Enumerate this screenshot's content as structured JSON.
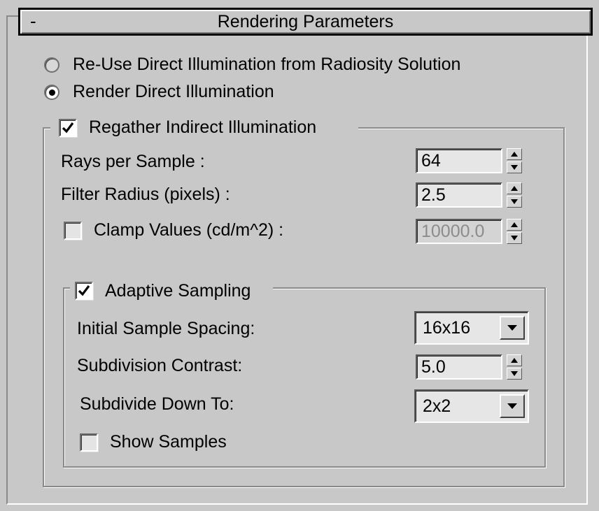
{
  "rollout": {
    "toggle": "-",
    "title": "Rendering Parameters"
  },
  "radios": [
    {
      "label": "Re-Use Direct Illumination from Radiosity Solution",
      "selected": false
    },
    {
      "label": "Render Direct Illumination",
      "selected": true
    }
  ],
  "regather": {
    "label": "Regather Indirect Illumination",
    "checked": true,
    "rays_label": "Rays per Sample :",
    "rays_value": "64",
    "filter_label": "Filter Radius (pixels) :",
    "filter_value": "2.5",
    "clamp_label": "Clamp Values (cd/m^2) :",
    "clamp_checked": false,
    "clamp_value": "10000.0"
  },
  "adaptive": {
    "label": "Adaptive Sampling",
    "checked": true,
    "initial_spacing_label": "Initial Sample Spacing:",
    "initial_spacing_value": "16x16",
    "contrast_label": "Subdivision Contrast:",
    "contrast_value": "5.0",
    "subdivide_label": "Subdivide Down To:",
    "subdivide_value": "2x2",
    "show_samples_label": "Show Samples",
    "show_samples_checked": false
  },
  "icons": {
    "check": "check-mark",
    "spinner_up": "triangle-up",
    "spinner_down": "triangle-down",
    "dropdown": "triangle-down"
  },
  "colors": {
    "panel_bg": "#c8c8c8",
    "field_bg": "#e6e6e6",
    "disabled_text": "#8c8c8c"
  }
}
